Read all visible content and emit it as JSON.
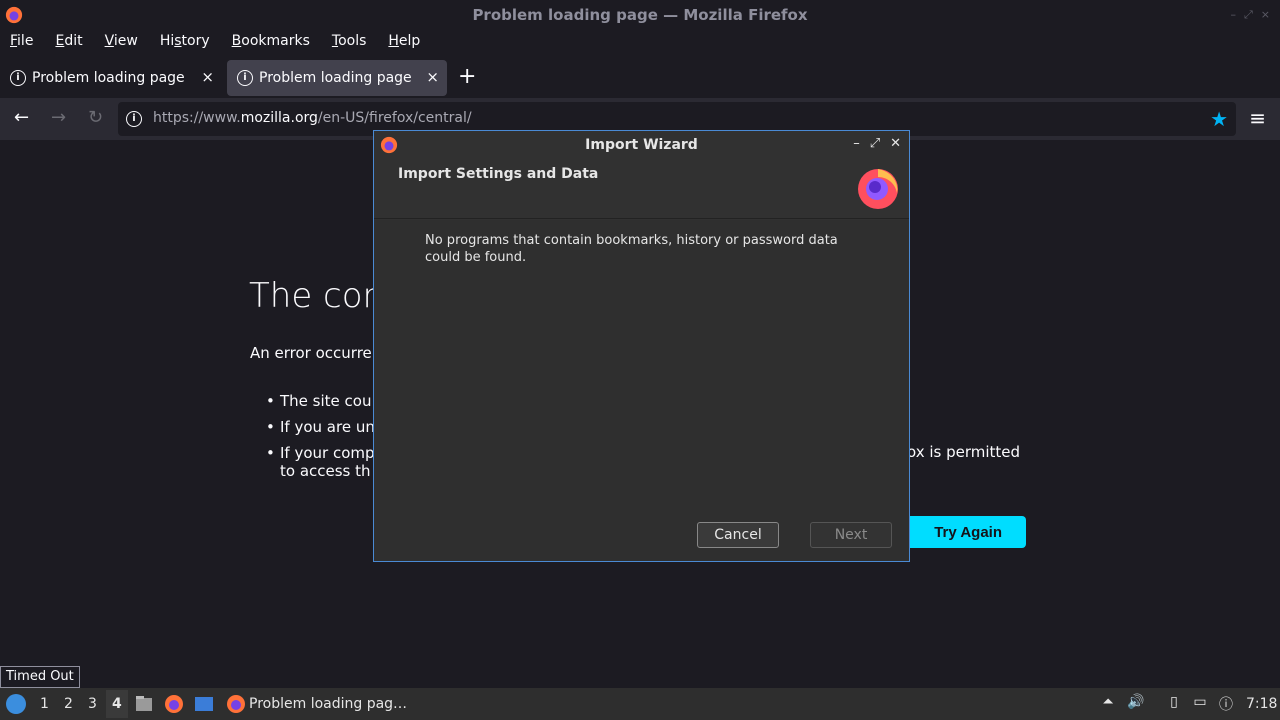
{
  "window": {
    "title": "Problem loading page — Mozilla Firefox",
    "controls": [
      "–",
      "⤢",
      "×"
    ]
  },
  "menubar": {
    "items": [
      {
        "mn": "F",
        "rest": "ile"
      },
      {
        "mn": "E",
        "rest": "dit"
      },
      {
        "mn": "V",
        "rest": "iew"
      },
      {
        "pre": "Hi",
        "mn": "s",
        "rest": "tory"
      },
      {
        "mn": "B",
        "rest": "ookmarks"
      },
      {
        "mn": "T",
        "rest": "ools"
      },
      {
        "mn": "H",
        "rest": "elp"
      }
    ]
  },
  "tabs": [
    {
      "label": "Problem loading page",
      "icon": "info-icon",
      "close": "×"
    },
    {
      "label": "Problem loading page",
      "icon": "info-icon",
      "close": "×"
    }
  ],
  "newtab_label": "+",
  "navbar": {
    "back": "←",
    "forward": "→",
    "reload": "↻",
    "url_prefix": "https://www.",
    "url_domain": "mozilla.org",
    "url_path": "/en-US/firefox/central/",
    "star": "★",
    "menu": "≡",
    "info": "i"
  },
  "page": {
    "title": "The con",
    "desc": "An error occurre",
    "bullets": [
      "The site cou",
      "If you are un",
      "If your comp"
    ],
    "bullet3_line2": "to access th",
    "right_text": "ox is permitted",
    "try_again": "Try Again"
  },
  "status_tip": "Timed Out",
  "dialog": {
    "title": "Import Wizard",
    "controls": [
      "–",
      "⤢",
      "✕"
    ],
    "heading": "Import Settings and Data",
    "message": "No programs that contain bookmarks, history or password data could be found.",
    "cancel": "Cancel",
    "next": "Next"
  },
  "taskbar": {
    "workspaces": [
      "1",
      "2",
      "3",
      "4"
    ],
    "task_label": "Problem loading pag…",
    "clock": "7:18"
  },
  "colors": {
    "accent": "#00ddff",
    "star": "#00b3f4",
    "dialog_border": "#4a8ad4"
  }
}
